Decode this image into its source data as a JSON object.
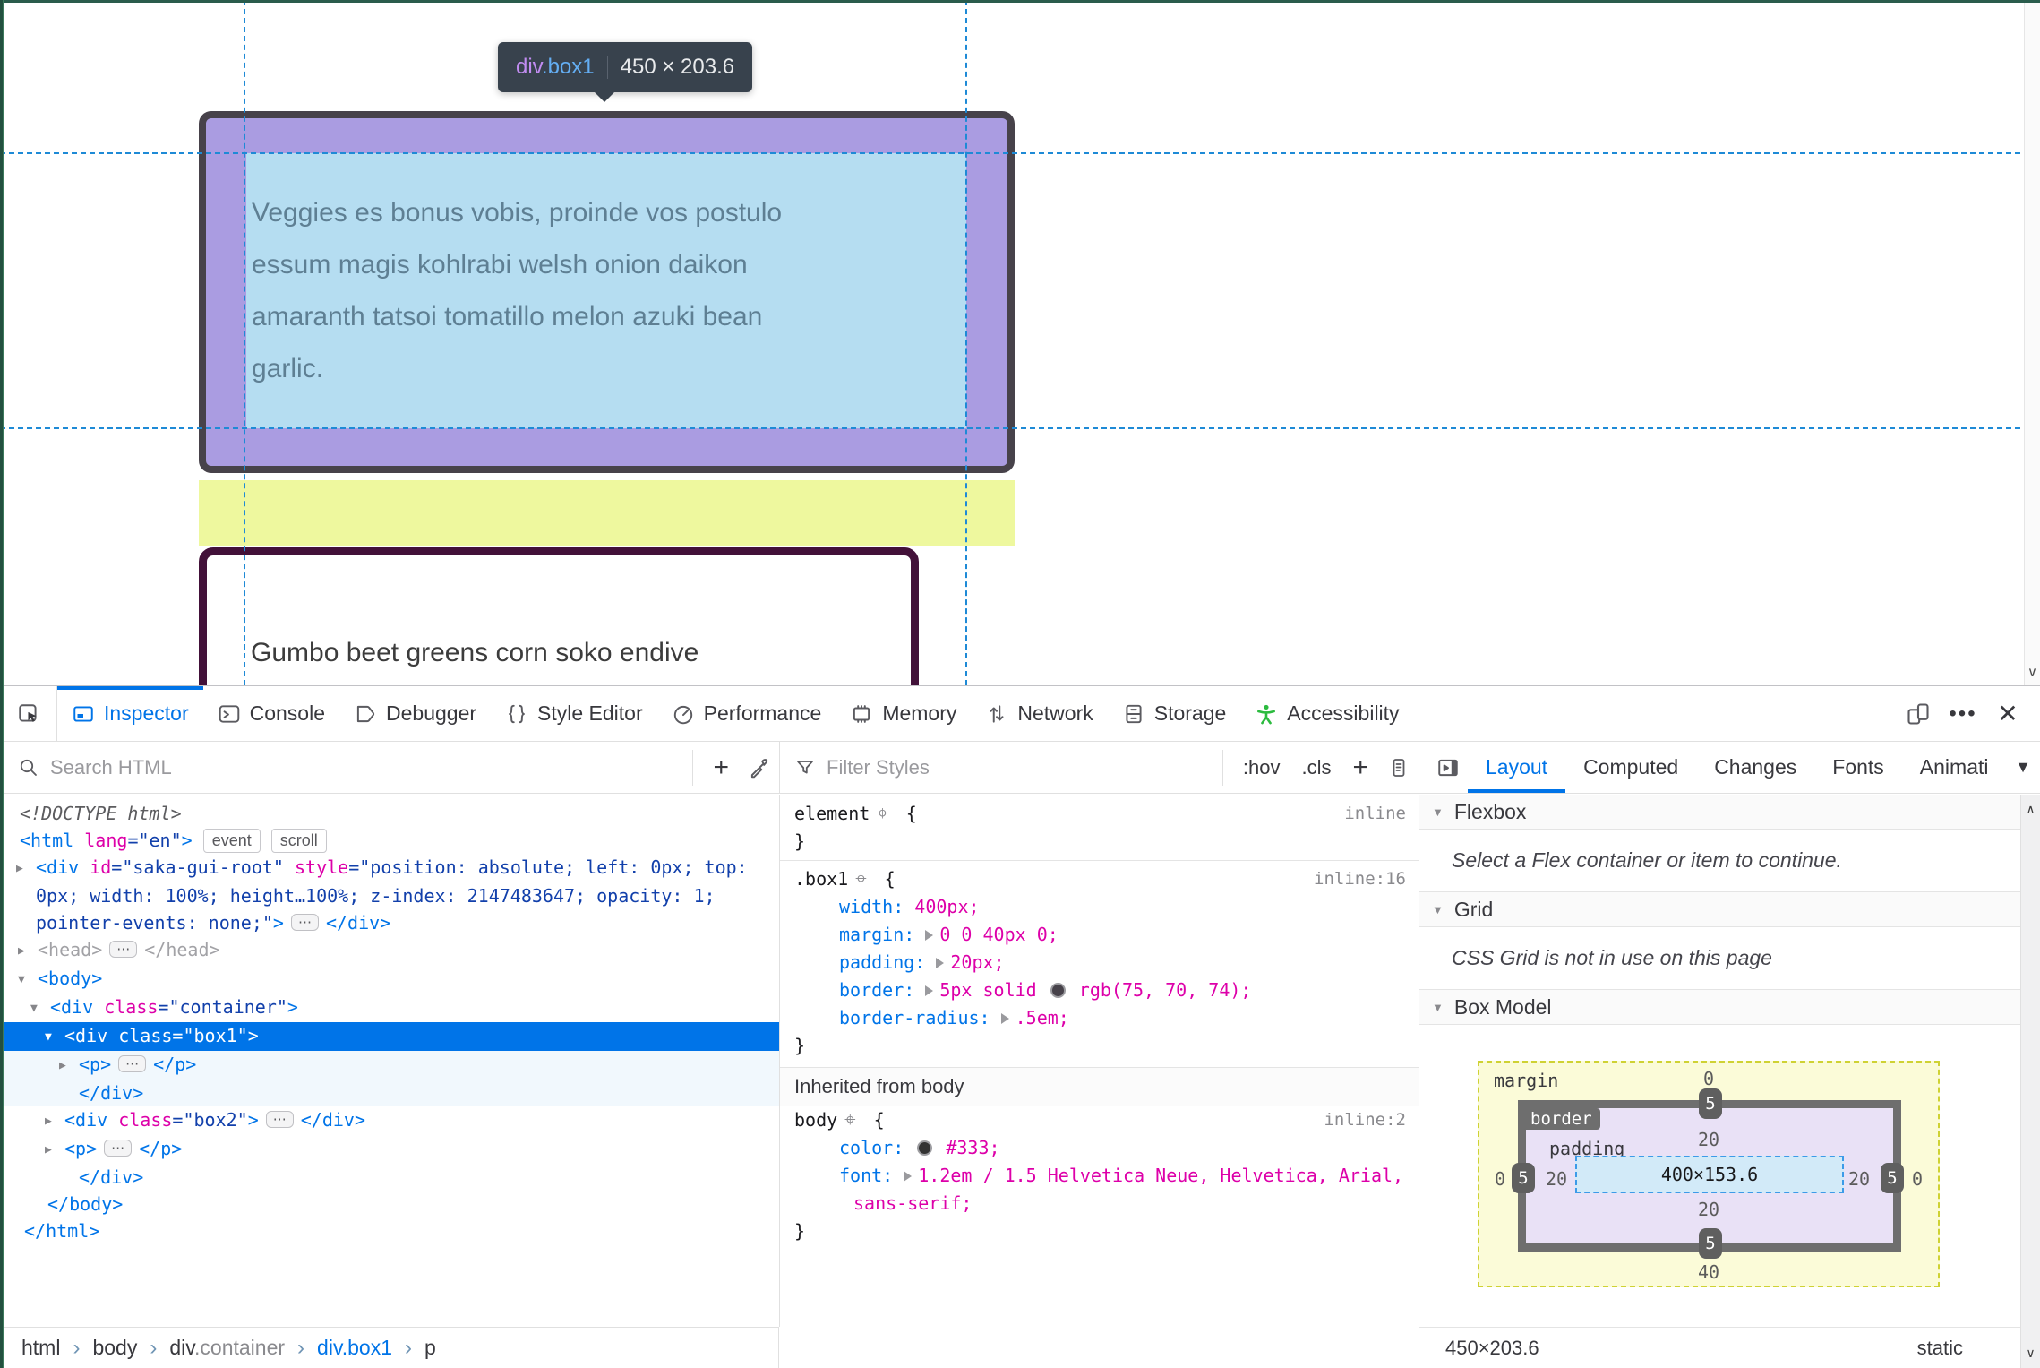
{
  "page": {
    "tooltip": {
      "tag": "div",
      "class_name": ".box1",
      "dims": "450 × 203.6"
    },
    "box1_lines": [
      "Veggies es bonus vobis, proinde vos postulo",
      "essum magis kohlrabi welsh onion daikon",
      "amaranth tatsoi tomatillo melon azuki bean",
      "garlic."
    ],
    "box2_text": "Gumbo beet greens corn soko endive",
    "highlight_colors": {
      "padding": "#aa9ce1",
      "content": "#b5ddf1",
      "margin": "#eef89e",
      "guide": "#1e8ad6"
    }
  },
  "devtools": {
    "tabs": [
      "Inspector",
      "Console",
      "Debugger",
      "Style Editor",
      "Performance",
      "Memory",
      "Network",
      "Storage",
      "Accessibility"
    ],
    "active_tab": "Inspector",
    "toolbar": {
      "search_placeholder": "Search HTML",
      "filter_placeholder": "Filter Styles",
      "hov": ":hov",
      "cls": ".cls",
      "plus": "+"
    },
    "sidebar_tabs": [
      "Layout",
      "Computed",
      "Changes",
      "Fonts",
      "Animati"
    ],
    "active_sidebar_tab": "Layout",
    "breadcrumb": [
      {
        "label": "html"
      },
      {
        "label": "body"
      },
      {
        "label": "div",
        "suffix": ".container"
      },
      {
        "label": "div.box1",
        "selected": true
      },
      {
        "label": "p"
      }
    ],
    "accent_color": "#0074e8"
  },
  "markup": {
    "rows": [
      {
        "indent": 22,
        "segs": [
          {
            "c": "doctype",
            "t": "<!DOCTYPE html>"
          }
        ]
      },
      {
        "indent": 22,
        "segs": [
          {
            "c": "tag",
            "t": "<html"
          },
          {
            "c": "atn",
            "t": " lang"
          },
          {
            "c": "atv",
            "t": "=\"en\""
          },
          {
            "c": "tag",
            "t": ">"
          },
          {
            "c": "badge",
            "t": "event"
          },
          {
            "c": "badge",
            "t": "scroll"
          }
        ]
      },
      {
        "indent": 40,
        "arrow": "▶",
        "segs": [
          {
            "c": "tag",
            "t": "<div"
          },
          {
            "c": "atn",
            "t": " id"
          },
          {
            "c": "atv",
            "t": "=\"saka-gui-root\""
          },
          {
            "c": "atn",
            "t": " style"
          },
          {
            "c": "atv",
            "t": "=\"position: absolute; left: 0px; top:"
          }
        ]
      },
      {
        "indent": 40,
        "segs": [
          {
            "c": "atv",
            "t": "0px; width: 100%; height…100%; z-index: 2147483647; opacity: 1;"
          }
        ]
      },
      {
        "indent": 40,
        "segs": [
          {
            "c": "atv",
            "t": "pointer-events: none;\""
          },
          {
            "c": "tag",
            "t": ">"
          },
          {
            "c": "dots"
          },
          {
            "c": "tag",
            "t": "</div>"
          }
        ]
      },
      {
        "indent": 42,
        "arrow": "▶",
        "segs": [
          {
            "c": "dim",
            "t": "<head>"
          },
          {
            "c": "dots"
          },
          {
            "c": "dim",
            "t": "</head>"
          }
        ]
      },
      {
        "indent": 42,
        "arrow": "▼",
        "segs": [
          {
            "c": "tag",
            "t": "<body>"
          }
        ]
      },
      {
        "indent": 56,
        "arrow": "▼",
        "segs": [
          {
            "c": "tag",
            "t": "<div"
          },
          {
            "c": "atn",
            "t": " class"
          },
          {
            "c": "atv",
            "t": "=\"container\""
          },
          {
            "c": "tag",
            "t": ">"
          }
        ]
      },
      {
        "indent": 72,
        "arrow": "▼",
        "sel": true,
        "segs": [
          {
            "c": "w",
            "t": "<div class=\"box1\">"
          }
        ]
      },
      {
        "indent": 88,
        "arrow": "▶",
        "bg": "child",
        "segs": [
          {
            "c": "tag",
            "t": "<p>"
          },
          {
            "c": "dots"
          },
          {
            "c": "tag",
            "t": "</p>"
          }
        ]
      },
      {
        "indent": 88,
        "bg": "child",
        "segs": [
          {
            "c": "tag",
            "t": "</div>"
          }
        ]
      },
      {
        "indent": 72,
        "arrow": "▶",
        "segs": [
          {
            "c": "tag",
            "t": "<div"
          },
          {
            "c": "atn",
            "t": " class"
          },
          {
            "c": "atv",
            "t": "=\"box2\""
          },
          {
            "c": "tag",
            "t": ">"
          },
          {
            "c": "dots"
          },
          {
            "c": "tag",
            "t": "</div>"
          }
        ]
      },
      {
        "indent": 72,
        "arrow": "▶",
        "segs": [
          {
            "c": "tag",
            "t": "<p>"
          },
          {
            "c": "dots"
          },
          {
            "c": "tag",
            "t": "</p>"
          }
        ]
      },
      {
        "indent": 88,
        "segs": [
          {
            "c": "tag",
            "t": "</div>"
          }
        ]
      },
      {
        "indent": 53,
        "segs": [
          {
            "c": "tag",
            "t": "</body>"
          }
        ]
      },
      {
        "indent": 27,
        "segs": [
          {
            "c": "tag",
            "t": "</html>"
          }
        ]
      }
    ]
  },
  "rules": {
    "rows": [
      {
        "type": "rule",
        "segs": [
          {
            "c": "rsel",
            "t": "element"
          },
          {
            "c": "target"
          },
          {
            "c": "rsel",
            "t": " {"
          }
        ],
        "meta": "inline"
      },
      {
        "type": "rule",
        "segs": [
          {
            "c": "rsel",
            "t": "}"
          }
        ]
      },
      {
        "type": "divider"
      },
      {
        "type": "rule",
        "segs": [
          {
            "c": "rsel",
            "t": ".box1"
          },
          {
            "c": "target"
          },
          {
            "c": "rsel",
            "t": " {"
          }
        ],
        "meta": "inline:16"
      },
      {
        "type": "rule",
        "indent": 50,
        "segs": [
          {
            "c": "prop",
            "t": "width: "
          },
          {
            "c": "valm",
            "t": "400px;"
          }
        ]
      },
      {
        "type": "rule",
        "indent": 50,
        "segs": [
          {
            "c": "prop",
            "t": "margin: "
          },
          {
            "c": "arr"
          },
          {
            "c": "valm",
            "t": "0 0 40px 0;"
          }
        ]
      },
      {
        "type": "rule",
        "indent": 50,
        "segs": [
          {
            "c": "prop",
            "t": "padding: "
          },
          {
            "c": "arr"
          },
          {
            "c": "valm",
            "t": "20px;"
          }
        ]
      },
      {
        "type": "rule",
        "indent": 50,
        "segs": [
          {
            "c": "prop",
            "t": "border: "
          },
          {
            "c": "arr"
          },
          {
            "c": "valm",
            "t": "5px solid "
          },
          {
            "c": "swatch",
            "color": "#47424a"
          },
          {
            "c": "valm",
            "t": " rgb(75, 70, 74);"
          }
        ]
      },
      {
        "type": "rule",
        "indent": 50,
        "segs": [
          {
            "c": "prop",
            "t": "border-radius: "
          },
          {
            "c": "arr"
          },
          {
            "c": "valm",
            "t": ".5em;"
          }
        ]
      },
      {
        "type": "rule",
        "segs": [
          {
            "c": "rsel",
            "t": "}"
          }
        ]
      },
      {
        "type": "section",
        "text": "Inherited from body"
      },
      {
        "type": "rule",
        "segs": [
          {
            "c": "rsel",
            "t": "body"
          },
          {
            "c": "target"
          },
          {
            "c": "rsel",
            "t": " {"
          }
        ],
        "meta": "inline:2"
      },
      {
        "type": "rule",
        "indent": 50,
        "segs": [
          {
            "c": "prop",
            "t": "color: "
          },
          {
            "c": "swatch",
            "color": "#333333"
          },
          {
            "c": "valm",
            "t": " #333;"
          }
        ]
      },
      {
        "type": "rule",
        "indent": 50,
        "segs": [
          {
            "c": "prop",
            "t": "font: "
          },
          {
            "c": "arr"
          },
          {
            "c": "valm",
            "t": "1.2em / 1.5 Helvetica Neue, Helvetica, Arial,"
          }
        ]
      },
      {
        "type": "rule",
        "indent": 66,
        "segs": [
          {
            "c": "valm",
            "t": "sans-serif;"
          }
        ]
      },
      {
        "type": "rule",
        "segs": [
          {
            "c": "rsel",
            "t": "}"
          }
        ]
      }
    ]
  },
  "layout_panel": {
    "flexbox_header": "Flexbox",
    "flexbox_message": "Select a Flex container or item to continue.",
    "grid_header": "Grid",
    "grid_message": "CSS Grid is not in use on this page",
    "box_model_header": "Box Model",
    "box_model": {
      "margin_label": "margin",
      "border_label": "border",
      "padding_label": "padding",
      "margin_top": "0",
      "margin_right": "0",
      "margin_bottom": "40",
      "margin_left": "0",
      "border_top": "5",
      "border_right": "5",
      "border_bottom": "5",
      "border_left": "5",
      "padding_top": "20",
      "padding_right": "20",
      "padding_bottom": "20",
      "padding_left": "20",
      "content": "400×153.6"
    },
    "footer": {
      "dimensions": "450×203.6",
      "position": "static"
    }
  }
}
